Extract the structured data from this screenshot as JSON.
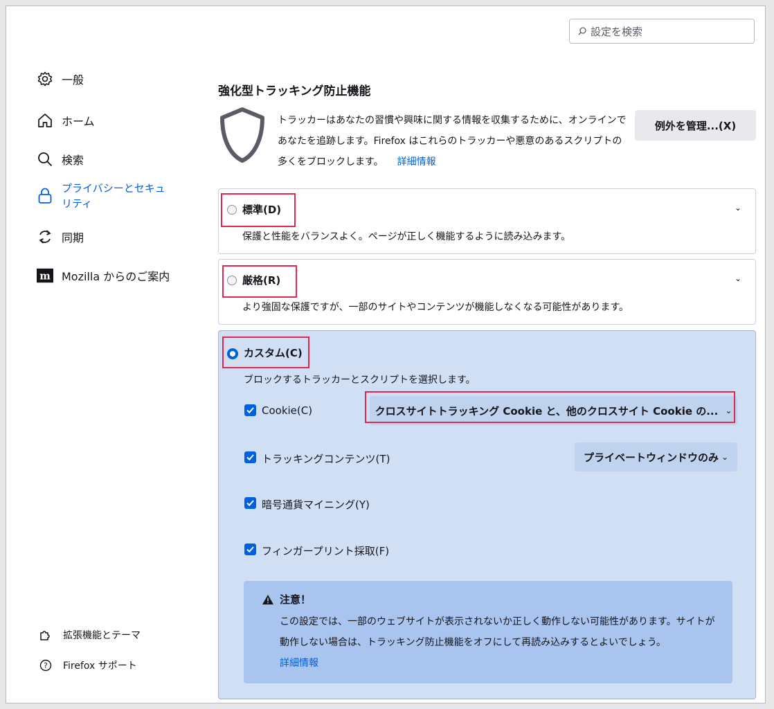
{
  "search": {
    "placeholder": "設定を検索"
  },
  "sidebar": {
    "items": [
      {
        "label": "一般"
      },
      {
        "label": "ホーム"
      },
      {
        "label": "検索"
      },
      {
        "label": "プライバシーとセキュリティ"
      },
      {
        "label": "同期"
      },
      {
        "label": "Mozilla からのご案内"
      }
    ],
    "footer": [
      {
        "label": "拡張機能とテーマ"
      },
      {
        "label": "Firefox サポート"
      }
    ]
  },
  "main": {
    "title": "強化型トラッキング防止機能",
    "description": "トラッカーはあなたの習慣や興味に関する情報を収集するために、オンラインであなたを追跡します。Firefox はこれらのトラッカーや悪意のあるスクリプトの多くをブロックします。",
    "learn_more": "詳細情報",
    "exceptions_button": "例外を管理...(X)",
    "options": {
      "standard": {
        "label": "標準(D)",
        "desc": "保護と性能をバランスよく。ページが正しく機能するように読み込みます。"
      },
      "strict": {
        "label": "厳格(R)",
        "desc": "より強固な保護ですが、一部のサイトやコンテンツが機能しなくなる可能性があります。"
      },
      "custom": {
        "label": "カスタム(C)",
        "desc": "ブロックするトラッカーとスクリプトを選択します。",
        "checks": [
          {
            "label": "Cookie(C)",
            "checked": true
          },
          {
            "label": "トラッキングコンテンツ(T)",
            "checked": true
          },
          {
            "label": "暗号通貨マイニング(Y)",
            "checked": true
          },
          {
            "label": "フィンガープリント採取(F)",
            "checked": true
          }
        ],
        "cookie_select": "クロスサイトトラッキング Cookie と、他のクロスサイト Cookie の...",
        "tracking_select": "プライベートウィンドウのみ",
        "warning": {
          "title": "注意！",
          "body": "この設定では、一部のウェブサイトが表示されないか正しく動作しない可能性があります。サイトが動作しない場合は、トラッキング防止機能をオフにして再読み込みするとよいでしょう。",
          "learn_more": "詳細情報"
        }
      }
    }
  },
  "colors": {
    "accent": "#0061e0",
    "highlight_box": "#e22850",
    "custom_bg": "#d1dff5"
  }
}
